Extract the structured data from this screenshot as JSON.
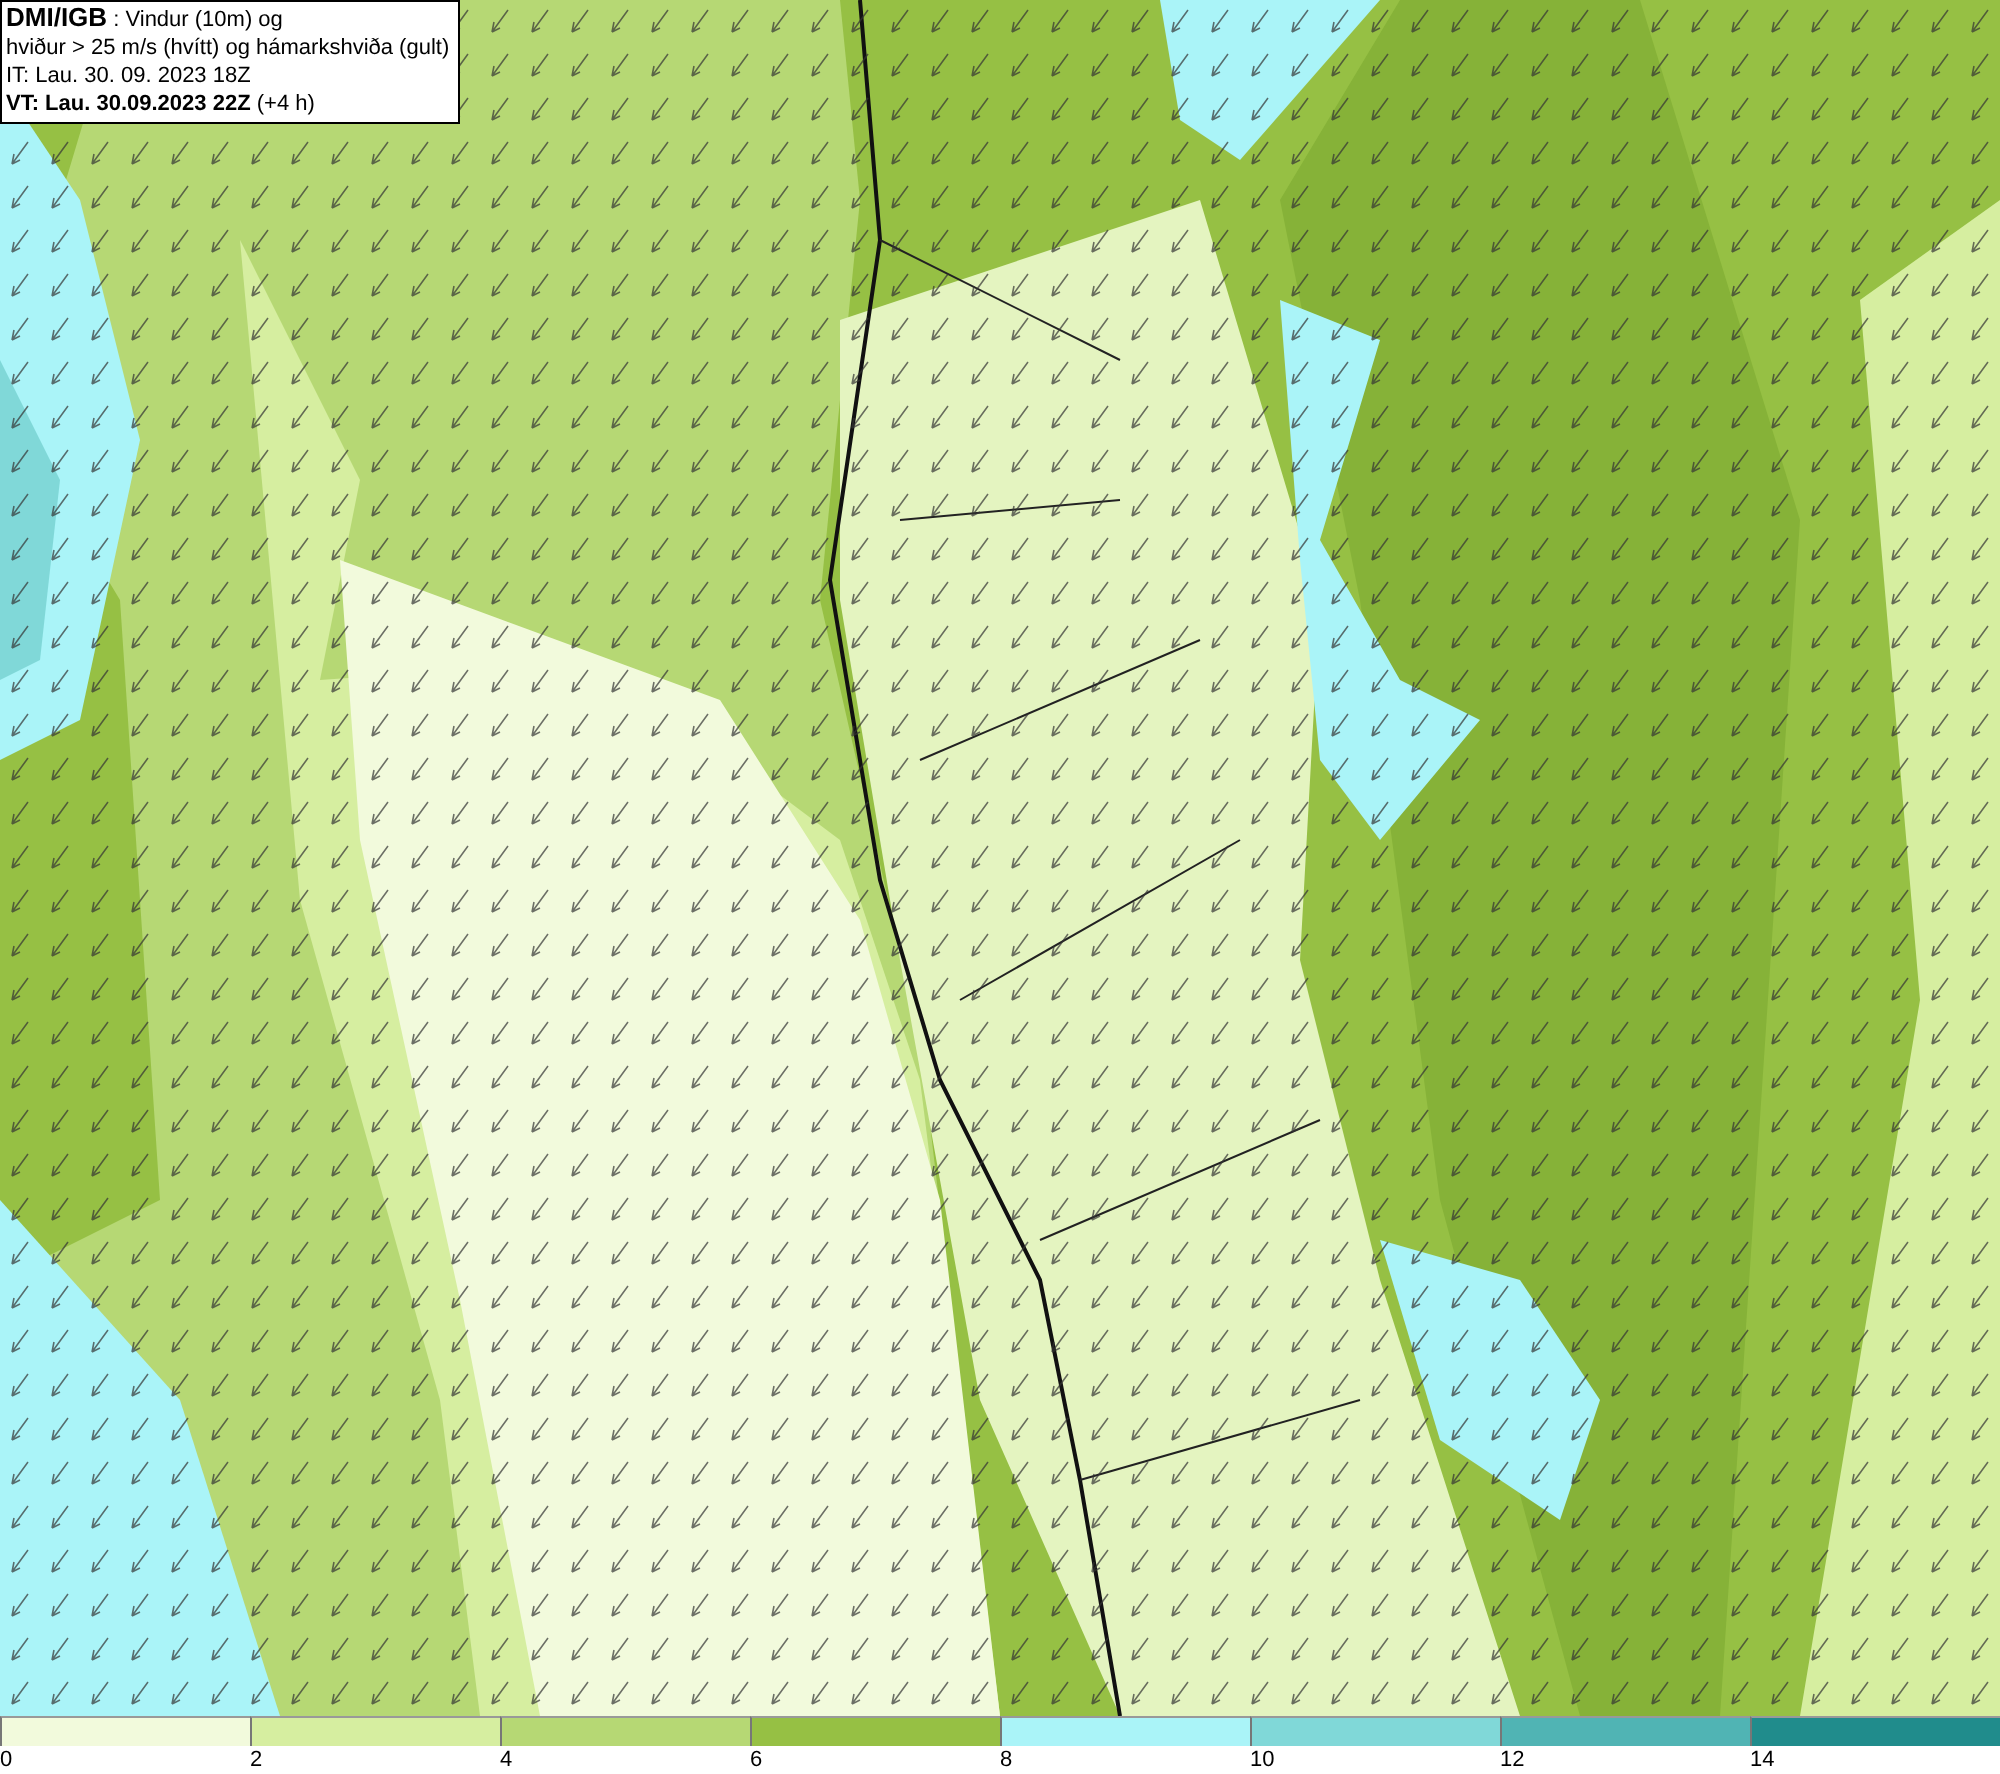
{
  "title_box": {
    "lines": [
      "**DMI/IGB** : Vindur (10m) og",
      "hviður > 25 m/s (hvítt) og hámarkshviða (gult)",
      "IT: Lau. 30. 09. 2023 18Z",
      "**VT: Lau. 30.09.2023 22Z** (+4 h)"
    ]
  },
  "legend": {
    "bins": [
      {
        "label": "0",
        "color": "#f2fadc"
      },
      {
        "label": "2",
        "color": "#d6eea0"
      },
      {
        "label": "4",
        "color": "#b6d874"
      },
      {
        "label": "6",
        "color": "#96c044"
      },
      {
        "label": "8",
        "color": "#aaf4f8"
      },
      {
        "label": "10",
        "color": "#80d8d8"
      },
      {
        "label": "12",
        "color": "#50b4b4"
      },
      {
        "label": "14",
        "color": "#208c8c"
      }
    ]
  }
}
